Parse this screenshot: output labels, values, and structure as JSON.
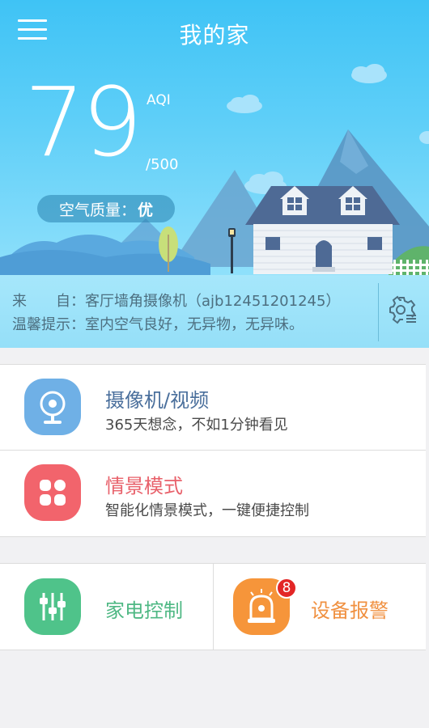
{
  "header": {
    "title": "我的家"
  },
  "air": {
    "aqi_value": "79",
    "aqi_unit": "AQI",
    "aqi_max": "/500",
    "quality_label": "空气质量：",
    "quality_value": "优"
  },
  "info": {
    "source_label": "来　　自：",
    "source_value": "客厅墙角摄像机（ajb12451201245）",
    "tip_label": "温馨提示：",
    "tip_value": "室内空气良好，无异物，无异味。"
  },
  "features": [
    {
      "title": "摄像机/视频",
      "subtitle": "365天想念，不如1分钟看见",
      "icon": "camera-icon",
      "color": "#6fb0e6",
      "title_color": "#4a6f9c"
    },
    {
      "title": "情景模式",
      "subtitle": "智能化情景模式，一键便捷控制",
      "icon": "scene-grid-icon",
      "color": "#f2646c",
      "title_color": "#e8606a"
    }
  ],
  "tiles": [
    {
      "title": "家电控制",
      "icon": "sliders-icon",
      "color": "#4fc38a",
      "title_color": "#4fb884"
    },
    {
      "title": "设备报警",
      "icon": "alarm-icon",
      "color": "#f6953a",
      "title_color": "#f09040",
      "badge": "8"
    }
  ]
}
